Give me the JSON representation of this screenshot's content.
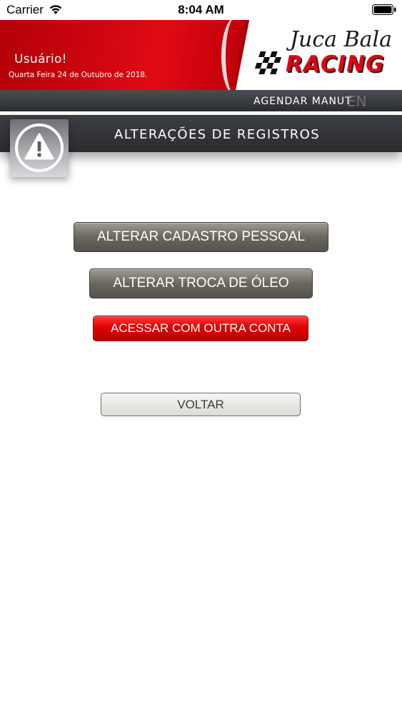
{
  "status_bar": {
    "carrier": "Carrier",
    "time": "8:04 AM",
    "icons": [
      "wifi-icon",
      "battery-icon"
    ]
  },
  "header": {
    "user": "Usuário!",
    "date": "Quarta Feira 24 de Outubro de 2018.",
    "logo_top": "Juca Bala",
    "logo_bottom": "RACING"
  },
  "menu": {
    "item": "AGENDAR MANUT",
    "ghost": "EN"
  },
  "section": {
    "title": "ALTERAÇÕES DE REGISTROS",
    "icon": "warning-icon"
  },
  "buttons": {
    "personal": "ALTERAR CADASTRO PESSOAL",
    "oil": "ALTERAR TROCA DE ÓLEO",
    "other_account": "ACESSAR COM OUTRA CONTA",
    "back": "VOLTAR"
  },
  "colors": {
    "brand_red": "#e00a14",
    "dark_bar": "#2b2d31",
    "gray_button": "#6a675f",
    "red_button": "#e00000"
  }
}
